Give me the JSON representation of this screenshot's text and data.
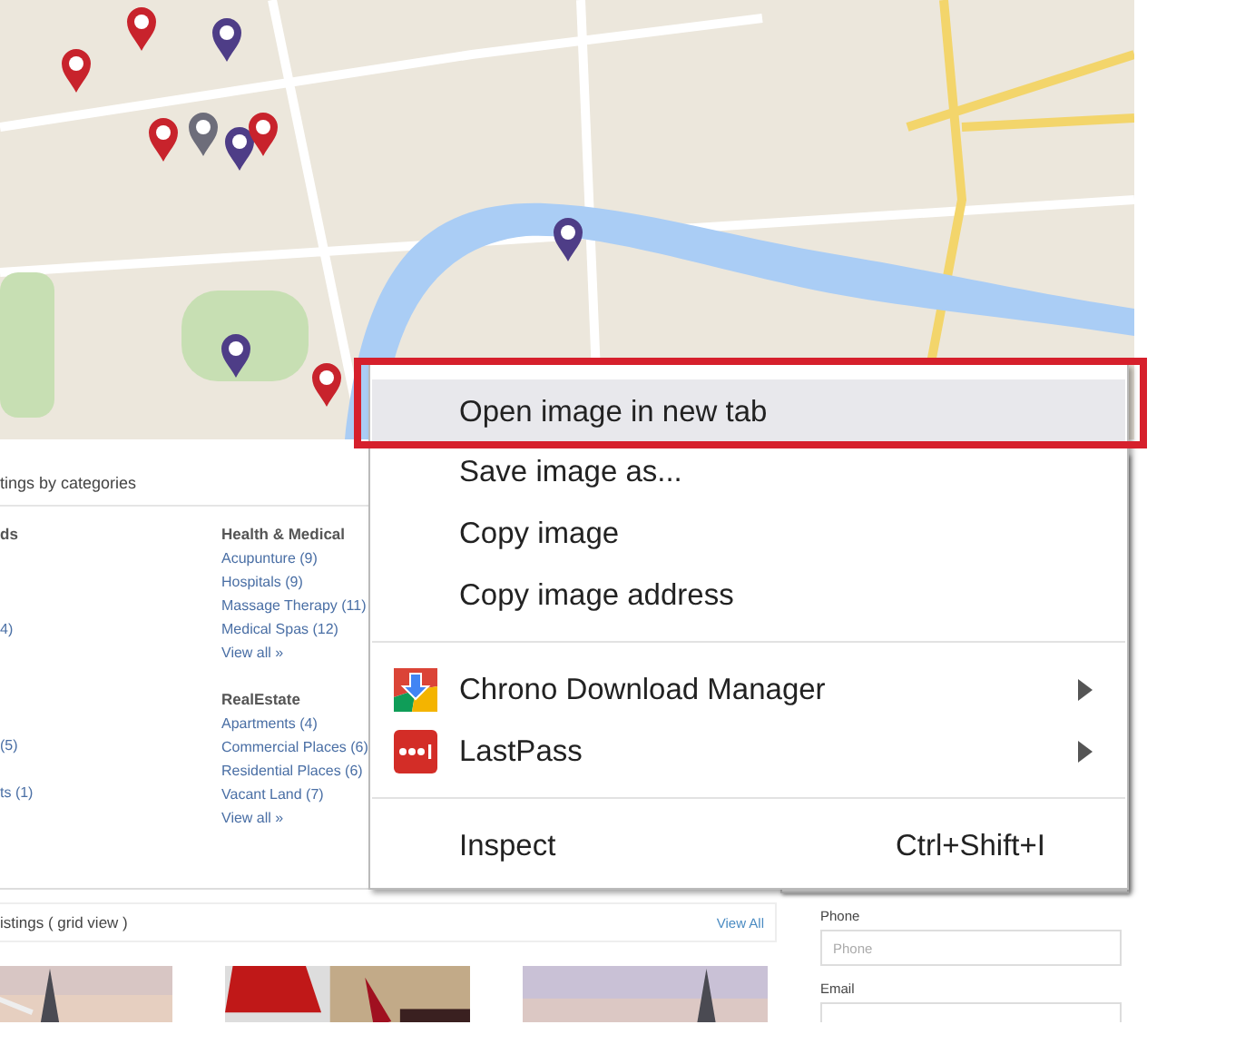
{
  "categories": {
    "title": "tings by categories",
    "columns": [
      {
        "rows": [
          {
            "kind": "heading",
            "text": "ds"
          },
          {
            "kind": "offscreen"
          },
          {
            "kind": "offscreen"
          },
          {
            "kind": "offscreen"
          },
          {
            "kind": "link",
            "text": "4)"
          },
          {
            "kind": "offscreen"
          },
          {
            "kind": "gap"
          },
          {
            "kind": "offscreen"
          },
          {
            "kind": "offscreen"
          },
          {
            "kind": "link",
            "text": "(5)"
          },
          {
            "kind": "offscreen"
          },
          {
            "kind": "link",
            "text": "ts (1)"
          }
        ]
      },
      {
        "rows": [
          {
            "kind": "heading",
            "text": "Health & Medical"
          },
          {
            "kind": "link",
            "text": "Acupunture (9)"
          },
          {
            "kind": "link",
            "text": "Hospitals (9)"
          },
          {
            "kind": "link",
            "text": "Massage Therapy (11)"
          },
          {
            "kind": "link",
            "text": "Medical Spas (12)"
          },
          {
            "kind": "more",
            "text": "View all »"
          },
          {
            "kind": "gap"
          },
          {
            "kind": "heading",
            "text": "RealEstate"
          },
          {
            "kind": "link",
            "text": "Apartments (4)"
          },
          {
            "kind": "link",
            "text": "Commercial Places (6)"
          },
          {
            "kind": "link",
            "text": "Residential Places (6)"
          },
          {
            "kind": "link",
            "text": "Vacant Land (7)"
          },
          {
            "kind": "more",
            "text": "View all »"
          }
        ]
      }
    ]
  },
  "listings": {
    "title": "istings ( grid view )",
    "link": "View All"
  },
  "contact": {
    "fields": [
      {
        "label": "Phone",
        "placeholder": "Phone"
      },
      {
        "label": "Email"
      }
    ]
  },
  "context_menu": {
    "items": [
      {
        "kind": "item",
        "label": "Open image in new tab",
        "selected": true
      },
      {
        "kind": "item",
        "label": "Save image as...",
        "selected": false
      },
      {
        "kind": "item",
        "label": "Copy image",
        "selected": false
      },
      {
        "kind": "item",
        "label": "Copy image address",
        "selected": false
      },
      {
        "kind": "separator"
      },
      {
        "kind": "extension",
        "label": "Chrono Download Manager",
        "selected": false,
        "submenu": true
      },
      {
        "kind": "extension",
        "label": "LastPass",
        "selected": false,
        "submenu": true
      },
      {
        "kind": "separator"
      },
      {
        "kind": "item",
        "label": "Inspect",
        "selected": false,
        "shortcut": "Ctrl+Shift+I"
      }
    ]
  }
}
